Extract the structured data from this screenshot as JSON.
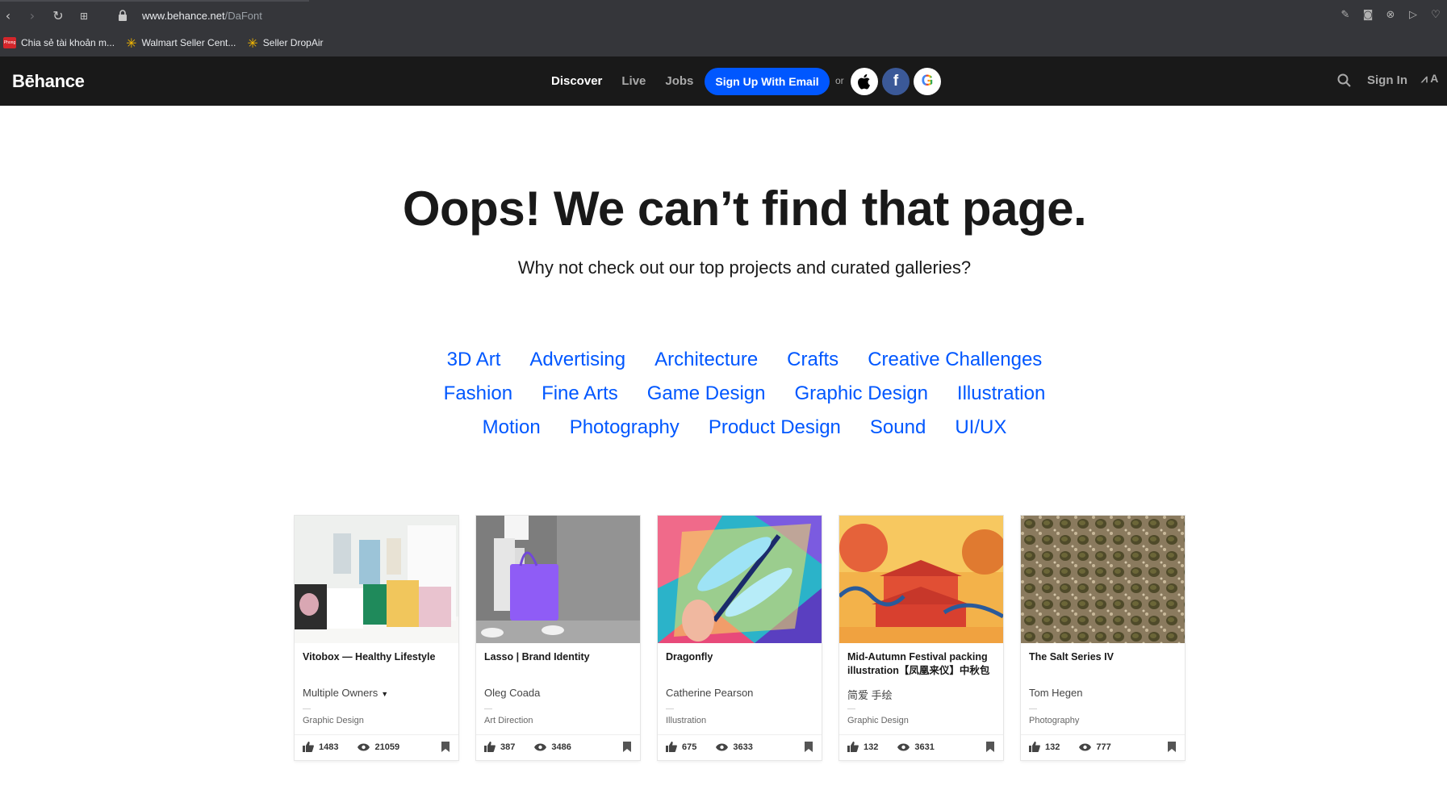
{
  "browser": {
    "url_host": "www.behance.net",
    "url_path": "/DaFont",
    "bookmarks": [
      {
        "label": "Chia sẻ tài khoản m...",
        "icon": "red-badge-icon"
      },
      {
        "label": "Walmart Seller Cent...",
        "icon": "walmart-spark-icon"
      },
      {
        "label": "Seller DropAir",
        "icon": "walmart-spark-icon"
      }
    ]
  },
  "header": {
    "logo": "Bēhance",
    "nav": [
      "Discover",
      "Live",
      "Jobs"
    ],
    "signup_label": "Sign Up With Email",
    "or_label": "or",
    "facebook_glyph": "f",
    "google_glyph": "G",
    "signin_label": "Sign In",
    "adobe_label": "A"
  },
  "main": {
    "headline": "Oops! We can’t find that page.",
    "subline": "Why not check out our top projects and curated galleries?",
    "categories": [
      [
        "3D Art",
        "Advertising",
        "Architecture",
        "Crafts",
        "Creative Challenges"
      ],
      [
        "Fashion",
        "Fine Arts",
        "Game Design",
        "Graphic Design",
        "Illustration"
      ],
      [
        "Motion",
        "Photography",
        "Product Design",
        "Sound",
        "UI/UX"
      ]
    ],
    "projects": [
      {
        "title": "Vitobox — Healthy Lifestyle",
        "owner": "Multiple Owners",
        "field": "Graphic Design",
        "likes": "1483",
        "views": "21059"
      },
      {
        "title": "Lasso | Brand Identity",
        "owner": "Oleg Coada",
        "field": "Art Direction",
        "likes": "387",
        "views": "3486"
      },
      {
        "title": "Dragonfly",
        "owner": "Catherine Pearson",
        "field": "Illustration",
        "likes": "675",
        "views": "3633"
      },
      {
        "title": "Mid-Autumn Festival packing illustration【凤凰来仪】中秋包",
        "owner": "简爱 手绘",
        "field": "Graphic Design",
        "likes": "132",
        "views": "3631"
      },
      {
        "title": "The Salt Series IV",
        "owner": "Tom Hegen",
        "field": "Photography",
        "likes": "132",
        "views": "777"
      }
    ]
  },
  "colors": {
    "brand_blue": "#0057ff",
    "nav_bg": "#191919",
    "chrome_bg": "#35363a"
  }
}
